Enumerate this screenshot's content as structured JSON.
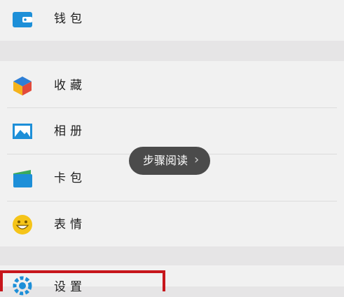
{
  "menu_items": [
    {
      "label": "钱包",
      "icon": "wallet-icon"
    },
    {
      "label": "收藏",
      "icon": "favorites-cube-icon"
    },
    {
      "label": "相册",
      "icon": "album-picture-icon"
    },
    {
      "label": "卡包",
      "icon": "card-wallet-icon"
    },
    {
      "label": "表情",
      "icon": "emoji-smile-icon"
    },
    {
      "label": "设置",
      "icon": "gear-icon"
    }
  ],
  "toast": {
    "text": "步骤阅读",
    "chevron": "›"
  },
  "colors": {
    "highlight": "#c7161c",
    "toast_bg": "#4b4b4b"
  }
}
